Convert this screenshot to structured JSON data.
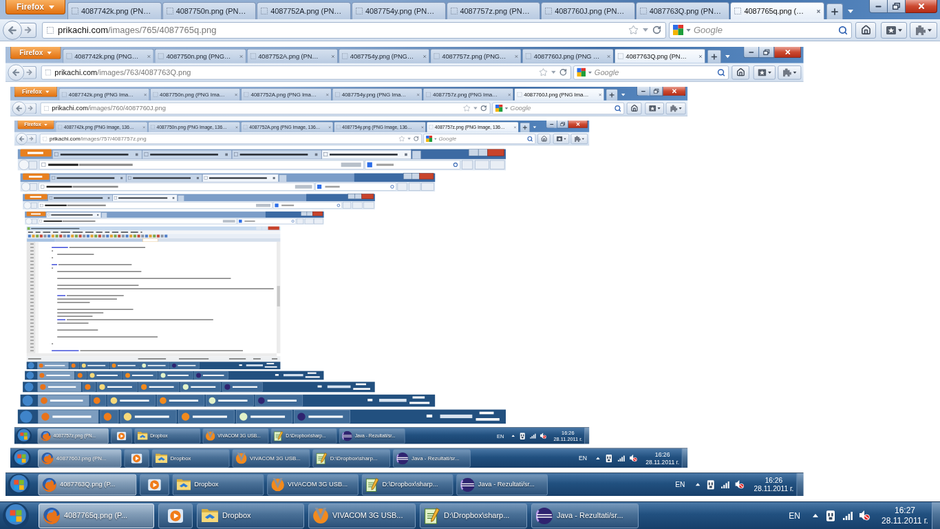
{
  "screen": {
    "kind": "desktop",
    "browser": {
      "menu_button": "Firefox",
      "tabs": [
        {
          "label": "4087742k.png (PN…",
          "selected": false,
          "close_button": false
        },
        {
          "label": "4087750n.png (PN…",
          "selected": false,
          "close_button": false
        },
        {
          "label": "4087752A.png (PN…",
          "selected": false,
          "close_button": false
        },
        {
          "label": "4087754y.png (PN…",
          "selected": false,
          "close_button": false
        },
        {
          "label": "4087757z.png (PN…",
          "selected": false,
          "close_button": false
        },
        {
          "label": "4087760J.png (PN…",
          "selected": false,
          "close_button": false
        },
        {
          "label": "4087763Q.png (PN…",
          "selected": false,
          "close_button": false
        },
        {
          "label": "4087765q.png (…",
          "selected": true,
          "close_button": true
        }
      ],
      "address": {
        "host": "prikachi.com",
        "path": "/images/765/4087765q.png"
      },
      "search": {
        "placeholder": "Google"
      },
      "image": {
        "kind": "desktop",
        "browser": {
          "menu_button": "Firefox",
          "tabs": [
            {
              "label": "4087742k.png (PNG…",
              "selected": false,
              "close_button": true
            },
            {
              "label": "4087750n.png (PNG…",
              "selected": false,
              "close_button": true
            },
            {
              "label": "4087752A.png (PN…",
              "selected": false,
              "close_button": true
            },
            {
              "label": "4087754y.png (PNG…",
              "selected": false,
              "close_button": true
            },
            {
              "label": "4087757z.png (PNG…",
              "selected": false,
              "close_button": true
            },
            {
              "label": "4087760J.png (PNG …",
              "selected": false,
              "close_button": true
            },
            {
              "label": "4087763Q.png (PN…",
              "selected": true,
              "close_button": true
            }
          ],
          "address": {
            "host": "prikachi.com",
            "path": "/images/763/4087763Q.png"
          },
          "search": {
            "placeholder": "Google"
          },
          "image": {
            "kind": "desktop",
            "browser": {
              "menu_button": "Firefox",
              "tabs": [
                {
                  "label": "4087742k.png (PNG Ima…",
                  "selected": false,
                  "close_button": true
                },
                {
                  "label": "4087750n.png (PNG Ima…",
                  "selected": false,
                  "close_button": true
                },
                {
                  "label": "4087752A.png (PNG Ima…",
                  "selected": false,
                  "close_button": true
                },
                {
                  "label": "4087754y.png (PNG Ima…",
                  "selected": false,
                  "close_button": true
                },
                {
                  "label": "4087757z.png (PNG Ima…",
                  "selected": false,
                  "close_button": true
                },
                {
                  "label": "4087760J.png (PNG Ima…",
                  "selected": true,
                  "close_button": true
                }
              ],
              "address": {
                "host": "prikachi.com",
                "path": "/images/760/4087760J.png"
              },
              "search": {
                "placeholder": "Google"
              },
              "image": {
                "kind": "desktop",
                "browser": {
                  "menu_button": "Firefox",
                  "tabs": [
                    {
                      "label": "4087742k.png (PNG Image, 136…",
                      "selected": false,
                      "close_button": true
                    },
                    {
                      "label": "4087750n.png (PNG Image, 136…",
                      "selected": false,
                      "close_button": true
                    },
                    {
                      "label": "4087752A.png (PNG Image, 136…",
                      "selected": false,
                      "close_button": true
                    },
                    {
                      "label": "4087754y.png (PNG Image, 136…",
                      "selected": false,
                      "close_button": true
                    },
                    {
                      "label": "4087757z.png (PNG Image, 136…",
                      "selected": true,
                      "close_button": true
                    }
                  ],
                  "address": {
                    "host": "prikachi.com",
                    "path": "/images/757/4087757z.png"
                  },
                  "search": {
                    "placeholder": "Google"
                  },
                  "image": {
                    "kind": "picture"
                  }
                },
                "taskbar": {
                  "items": [
                    {
                      "kind": "browser",
                      "label": "4087757z.png (PN...",
                      "selected": true
                    },
                    {
                      "kind": "player",
                      "selected": false
                    },
                    {
                      "kind": "folder",
                      "label": "Dropbox",
                      "selected": false
                    },
                    {
                      "kind": "modem",
                      "label": "VIVACOM 3G USB...",
                      "selected": false
                    },
                    {
                      "kind": "notepad",
                      "label": "D:\\Dropbox\\sharp...",
                      "selected": false
                    },
                    {
                      "kind": "ide",
                      "label": "Java - Rezultati/sr...",
                      "selected": false
                    }
                  ],
                  "language": "EN",
                  "time": "16:26",
                  "date": "28.11.2011 г."
                }
              }
            },
            "taskbar": {
              "items": [
                {
                  "kind": "browser",
                  "label": "4087760J.png (PN...",
                  "selected": true
                },
                {
                  "kind": "player",
                  "selected": false
                },
                {
                  "kind": "folder",
                  "label": "Dropbox",
                  "selected": false
                },
                {
                  "kind": "modem",
                  "label": "VIVACOM 3G USB...",
                  "selected": false
                },
                {
                  "kind": "notepad",
                  "label": "D:\\Dropbox\\sharp...",
                  "selected": false
                },
                {
                  "kind": "ide",
                  "label": "Java - Rezultati/sr...",
                  "selected": false
                }
              ],
              "language": "EN",
              "time": "16:26",
              "date": "28.11.2011 г."
            }
          }
        },
        "taskbar": {
          "items": [
            {
              "kind": "browser",
              "label": "4087763Q.png (P...",
              "selected": true
            },
            {
              "kind": "player",
              "selected": false
            },
            {
              "kind": "folder",
              "label": "Dropbox",
              "selected": false
            },
            {
              "kind": "modem",
              "label": "VIVACOM 3G USB...",
              "selected": false
            },
            {
              "kind": "notepad",
              "label": "D:\\Dropbox\\sharp...",
              "selected": false
            },
            {
              "kind": "ide",
              "label": "Java - Rezultati/sr...",
              "selected": false
            }
          ],
          "language": "EN",
          "time": "16:26",
          "date": "28.11.2011 г."
        }
      }
    },
    "taskbar": {
      "items": [
        {
          "kind": "browser",
          "label": "4087765q.png (P...",
          "selected": true
        },
        {
          "kind": "player",
          "selected": false
        },
        {
          "kind": "folder",
          "label": "Dropbox",
          "selected": false
        },
        {
          "kind": "modem",
          "label": "VIVACOM 3G USB...",
          "selected": false
        },
        {
          "kind": "notepad",
          "label": "D:\\Dropbox\\sharp...",
          "selected": false
        },
        {
          "kind": "ide",
          "label": "Java - Rezultati/sr...",
          "selected": false
        }
      ],
      "language": "EN",
      "time": "16:27",
      "date": "28.11.2011 г."
    }
  }
}
